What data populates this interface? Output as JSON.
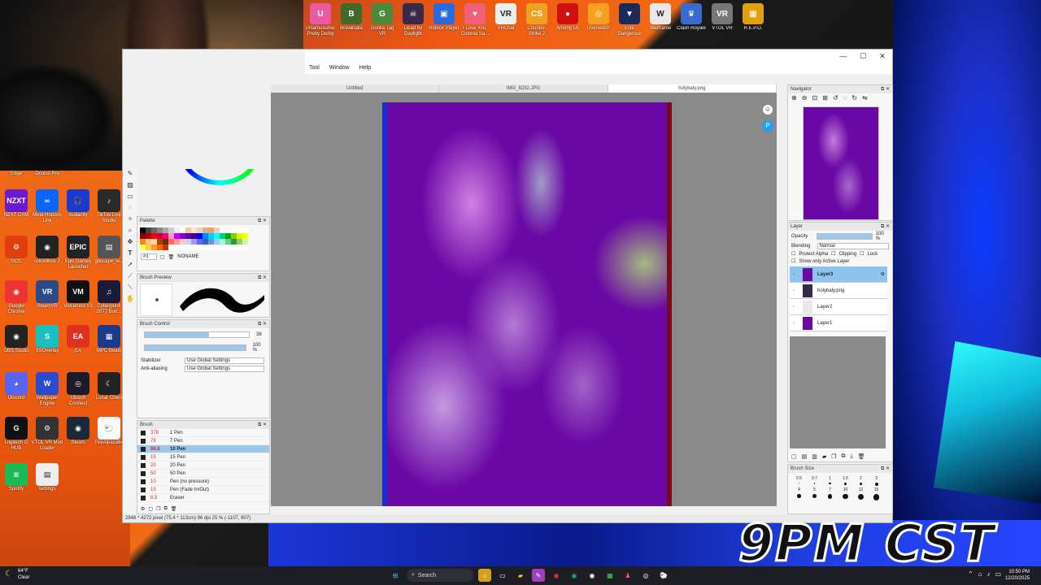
{
  "overlay": {
    "schedule": "9PM CST"
  },
  "shortcuts": [
    {
      "label": "Umamusume: Pretty Derby",
      "color": "#e95aa0",
      "glyph": "U"
    },
    {
      "label": "Brawlhalla",
      "color": "#3f6a2a",
      "glyph": "B"
    },
    {
      "label": "Gorilla Tag VR",
      "color": "#4a8a3a",
      "glyph": "G"
    },
    {
      "label": "Dead by Daylight",
      "color": "#3a2a4a",
      "glyph": "☠"
    },
    {
      "label": "Roblox Player",
      "color": "#2a6adf",
      "glyph": "▣"
    },
    {
      "label": "I Love You, Colonel Sa...",
      "color": "#f0607a",
      "glyph": "♥"
    },
    {
      "label": "VRChat",
      "color": "#eeeeee",
      "glyph": "VR"
    },
    {
      "label": "Counter-Strike 2",
      "color": "#f0a020",
      "glyph": "CS"
    },
    {
      "label": "Among Us",
      "color": "#d01010",
      "glyph": "●"
    },
    {
      "label": "Overwatch",
      "color": "#f4a020",
      "glyph": "◎"
    },
    {
      "label": "Elite Dangerous",
      "color": "#1a2a5a",
      "glyph": "▼"
    },
    {
      "label": "Warframe",
      "color": "#e8e8e8",
      "glyph": "W"
    },
    {
      "label": "Clash Royale",
      "color": "#3a6ad0",
      "glyph": "♛"
    },
    {
      "label": "VTOL VR",
      "color": "#777",
      "glyph": "VR"
    },
    {
      "label": "R.E.P.O.",
      "color": "#e0a010",
      "glyph": "▦"
    }
  ],
  "desktop_icons": [
    {
      "label": "Edge",
      "color": "#1e88e5",
      "glyph": "e"
    },
    {
      "label": "Oculus Pro",
      "color": "#333",
      "glyph": "◎"
    },
    {
      "label": "NZXT CAM",
      "color": "#6a1ad0",
      "glyph": "NZXT"
    },
    {
      "label": "Meta Horizon Link",
      "color": "#0866ff",
      "glyph": "∞"
    },
    {
      "label": "Audacity",
      "color": "#1a3ad0",
      "glyph": "🎧"
    },
    {
      "label": "TikTok Live Studio",
      "color": "#2a2a2a",
      "glyph": "♪"
    },
    {
      "label": "GCC",
      "color": "#e04010",
      "glyph": "⚙"
    },
    {
      "label": "rekordbox 7",
      "color": "#222",
      "glyph": "◉"
    },
    {
      "label": "Epic Games Launcher",
      "color": "#222",
      "glyph": "EPIC"
    },
    {
      "label": "gdscape_w...",
      "color": "#555",
      "glyph": "▤"
    },
    {
      "label": "Google Chrome",
      "color": "#e33",
      "glyph": "◉"
    },
    {
      "label": "SteamVR",
      "color": "#2a4a8a",
      "glyph": "VR"
    },
    {
      "label": "Voicemod V3",
      "color": "#111",
      "glyph": "VM"
    },
    {
      "label": "Cyberpunk 2077 Bon...",
      "color": "#1a1a3a",
      "glyph": "♫"
    },
    {
      "label": "OBS Studio",
      "color": "#222",
      "glyph": "◉"
    },
    {
      "label": "XSOverlay",
      "color": "#1ac0c0",
      "glyph": "S"
    },
    {
      "label": "EA",
      "color": "#e03020",
      "glyph": "EA"
    },
    {
      "label": "MPC Beats",
      "color": "#1a3a8a",
      "glyph": "▦"
    },
    {
      "label": "Discord",
      "color": "#5865f2",
      "glyph": "◕"
    },
    {
      "label": "Wallpaper Engine",
      "color": "#2a4ad0",
      "glyph": "W"
    },
    {
      "label": "Ubisoft Connect",
      "color": "#1a1a2a",
      "glyph": "◎"
    },
    {
      "label": "Lunar Client",
      "color": "#222",
      "glyph": "☾"
    },
    {
      "label": "Logitech G HUB",
      "color": "#111",
      "glyph": "G"
    },
    {
      "label": "VTOL VR Mod Loader",
      "color": "#333",
      "glyph": "⚙"
    },
    {
      "label": "Steam",
      "color": "#1b2838",
      "glyph": "◉"
    },
    {
      "label": "FireAlpaca64",
      "color": "#fafafa",
      "glyph": "🐑"
    },
    {
      "label": "Spotify",
      "color": "#1db954",
      "glyph": "≋"
    },
    {
      "label": "settings",
      "color": "#eee",
      "glyph": "▤"
    }
  ],
  "window": {
    "controls": [
      "—",
      "☐",
      "✕"
    ],
    "menu": [
      "Tool",
      "Window",
      "Help"
    ],
    "tabs": [
      "Untitled",
      "IMG_8232.JPG",
      "holybaly.png"
    ],
    "active_tab": 2,
    "status": "2848 * 4272 pixel   (75.4 * 113cm)   96 dpi   25 %   (-1107, 607)"
  },
  "palette": {
    "title": "Palette",
    "number": "#1",
    "name": "NONAME",
    "colors": [
      "#000",
      "#444",
      "#666",
      "#888",
      "#aaa",
      "#ccc",
      "#eee",
      "#fff",
      "#f4c7a0",
      "#fce4d0",
      "#e8d4c0",
      "#d4b090",
      "#f0a070",
      "#f0d0b0",
      "#fff",
      "#fff",
      "#fff",
      "#fff",
      "#fff",
      "#800",
      "#a00",
      "#f00",
      "#c04",
      "#f06",
      "#f9c",
      "#c0f",
      "#80c",
      "#60a",
      "#408",
      "#00f",
      "#08f",
      "#0cf",
      "#0ff",
      "#0c8",
      "#0a0",
      "#8c0",
      "#cf0",
      "#ff0",
      "#f80",
      "#fc8",
      "#fda",
      "#a40",
      "#630",
      "#f66",
      "#f99",
      "#fcc",
      "#ccf",
      "#99f",
      "#66f",
      "#36c",
      "#69c",
      "#9cf",
      "#9fc",
      "#6c9",
      "#393",
      "#9c6",
      "#cf9",
      "#ff6",
      "#fc3",
      "#f93",
      "#f60",
      "#c30",
      "#fff",
      "#fff",
      "#fff",
      "#fff",
      "#fff",
      "#fff",
      "#fff",
      "#fff",
      "#fff",
      "#fff",
      "#fff",
      "#fff",
      "#fff",
      "#fff"
    ]
  },
  "brush_preview": {
    "title": "Brush Preview"
  },
  "brush_control": {
    "title": "Brush Control",
    "size_value": "38",
    "size_fill": 0.62,
    "opacity_value": "100 %",
    "opacity_fill": 1.0,
    "stabilizer_label": "Stabilizer",
    "stabilizer_value": "Use Global Settings",
    "antialias_label": "Anti-aliasing",
    "antialias_value": "Use Global Settings"
  },
  "brush": {
    "title": "Brush",
    "items": [
      {
        "size": "378",
        "name": "1 Pen"
      },
      {
        "size": "78",
        "name": "7 Pen"
      },
      {
        "size": "98.8",
        "name": "10 Pen"
      },
      {
        "size": "15",
        "name": "15 Pen"
      },
      {
        "size": "20",
        "name": "20 Pen"
      },
      {
        "size": "50",
        "name": "50 Pen"
      },
      {
        "size": "10",
        "name": "Pen (no pressure)"
      },
      {
        "size": "15",
        "name": "Pen (Fade In/Out)"
      },
      {
        "size": "8.5",
        "name": "Eraser"
      }
    ],
    "selected": 2
  },
  "navigator": {
    "title": "Navigator"
  },
  "layer": {
    "title": "Layer",
    "opacity_label": "Opacity",
    "opacity_value": "100 %",
    "blending_label": "Blending",
    "blending_value": "Normal",
    "protect_alpha": "Protect Alpha",
    "clipping": "Clipping",
    "lock": "Lock",
    "show_only_active": "Show only Active Layer",
    "layers": [
      {
        "name": "Layer3",
        "thumb": "#6a08a6"
      },
      {
        "name": "holybaly.png",
        "thumb": "#3a2a4a"
      },
      {
        "name": "Layer2",
        "thumb": "#e8e8e8"
      },
      {
        "name": "Layer1",
        "thumb": "#6a08a6"
      }
    ],
    "active": 0
  },
  "brush_size": {
    "title": "Brush Size",
    "values": [
      "0.5",
      "0.7",
      "1",
      "1.5",
      "2",
      "3",
      "4",
      "5",
      "7",
      "10",
      "12",
      "15"
    ]
  },
  "taskbar": {
    "temperature": "64°F",
    "condition": "Clear",
    "search_placeholder": "Search",
    "time": "10:50 PM",
    "date": "12/20/2025"
  }
}
